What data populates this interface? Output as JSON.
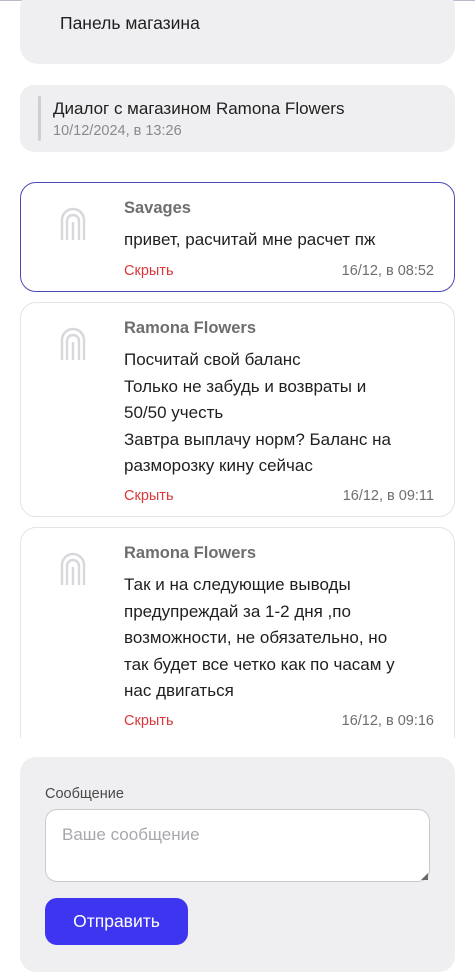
{
  "panel": {
    "title": "Панель магазина"
  },
  "dialog": {
    "title": "Диалог с магазином Ramona Flowers",
    "date": "10/12/2024, в 13:26"
  },
  "messages": [
    {
      "author": "Savages",
      "lines": [
        "привет, расчитай мне расчет пж"
      ],
      "hide_label": "Скрыть",
      "time": "16/12, в 08:52",
      "active": true
    },
    {
      "author": "Ramona Flowers",
      "lines": [
        "Посчитай свой баланс",
        "Только не забудь и возвраты и",
        "50/50 учесть",
        "Завтра выплачу норм? Баланс на",
        "разморозку кину сейчас"
      ],
      "hide_label": "Скрыть",
      "time": "16/12, в 09:11",
      "active": false
    },
    {
      "author": "Ramona Flowers",
      "lines": [
        "Так и на следующие выводы",
        "предупреждай за 1-2 дня ,по",
        "возможности, не обязательно, но",
        "так будет все четко как по часам у",
        "нас двигаться"
      ],
      "hide_label": "Скрыть",
      "time": "16/12, в 09:16",
      "active": false
    }
  ],
  "composer": {
    "label": "Сообщение",
    "placeholder": "Ваше сообщение",
    "value": "",
    "send_label": "Отправить"
  },
  "icons": {
    "avatar": "store-logo-icon"
  },
  "colors": {
    "accent": "#3d35f0",
    "active_border": "#4b4ab8",
    "hide_link": "#d9383a",
    "card_bg": "#efeff1"
  }
}
